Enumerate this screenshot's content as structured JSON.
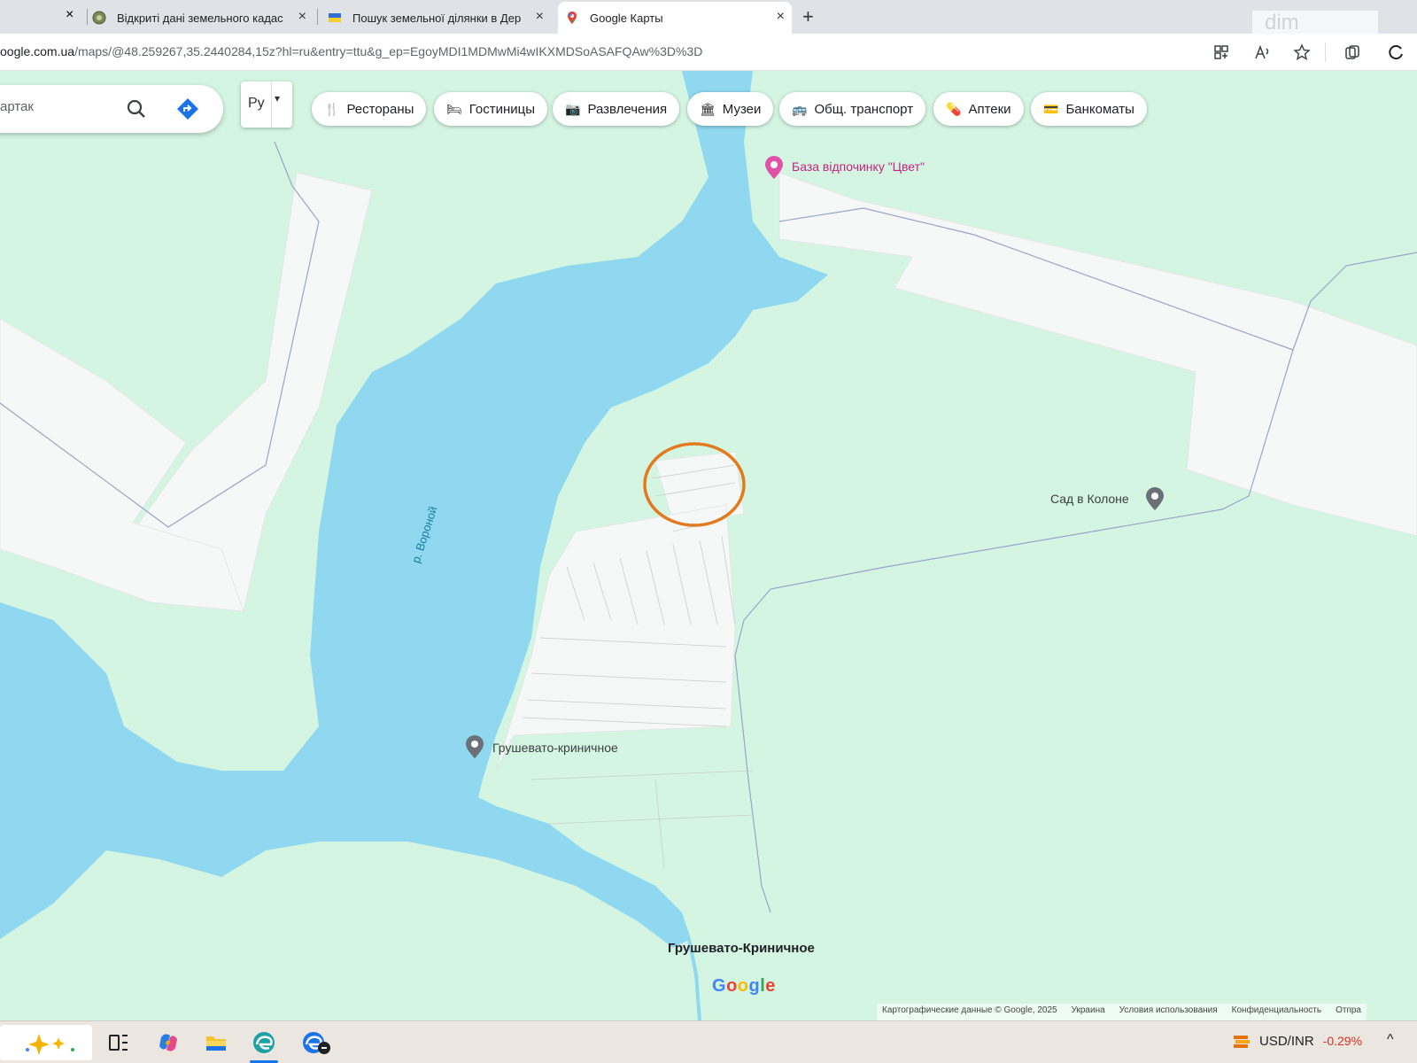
{
  "browser": {
    "tabs": [
      {
        "title": "Відкриті дані земельного кадас",
        "active": false
      },
      {
        "title": "Пошук земельної ділянки в Дер",
        "active": false
      },
      {
        "title": "Google Карты",
        "active": true
      }
    ],
    "new_tab_label": "+",
    "close_label": "×",
    "url_host": "oogle.com.ua",
    "url_path": "/maps/@48.259267,35.2440284,15z?hl=ru&entry=ttu&g_ep=EgoyMDI1MDMwMi4wIKXMDSoASAFQAw%3D%3D",
    "watermark": "dim"
  },
  "maps": {
    "search": {
      "value": "артак"
    },
    "language": {
      "label": "Ру",
      "arrow": "▾"
    },
    "chips": [
      {
        "icon": "restaurant-icon",
        "glyph": "🍴",
        "label": "Рестораны"
      },
      {
        "icon": "hotel-icon",
        "glyph": "🛏",
        "label": "Гостиницы"
      },
      {
        "icon": "camera-icon",
        "glyph": "📷",
        "label": "Развлечения"
      },
      {
        "icon": "museum-icon",
        "glyph": "🏛",
        "label": "Музеи"
      },
      {
        "icon": "bus-icon",
        "glyph": "🚌",
        "label": "Общ. транспорт"
      },
      {
        "icon": "pharmacy-icon",
        "glyph": "💊",
        "label": "Аптеки"
      },
      {
        "icon": "atm-icon",
        "glyph": "💳",
        "label": "Банкоматы"
      }
    ],
    "places": {
      "resort": "База відпочинку \"Цвет\"",
      "garden": "Сад в Колоне",
      "village_pin": "Грушевато-криничное",
      "river": "р. Вороной",
      "town": "Грушевато-Криничное"
    },
    "logo": "Google",
    "logo_colors": [
      "#4285F4",
      "#EA4335",
      "#FBBC05",
      "#4285F4",
      "#34A853",
      "#EA4335"
    ],
    "attribution": [
      "Картографические данные © Google, 2025",
      "Украина",
      "Условия использования",
      "Конфиденциальность",
      "Отпра"
    ]
  },
  "taskbar": {
    "ticker_symbol": "USD/INR",
    "ticker_change": "-0.29%",
    "chevron": "^"
  },
  "colors": {
    "water": "#8fd8ef",
    "land": "#d5f5e3",
    "field": "#f5f8f6",
    "highlight_circle": "#e37a1e",
    "resort_pin": "#e052a8",
    "place_pin": "#6b7076"
  }
}
